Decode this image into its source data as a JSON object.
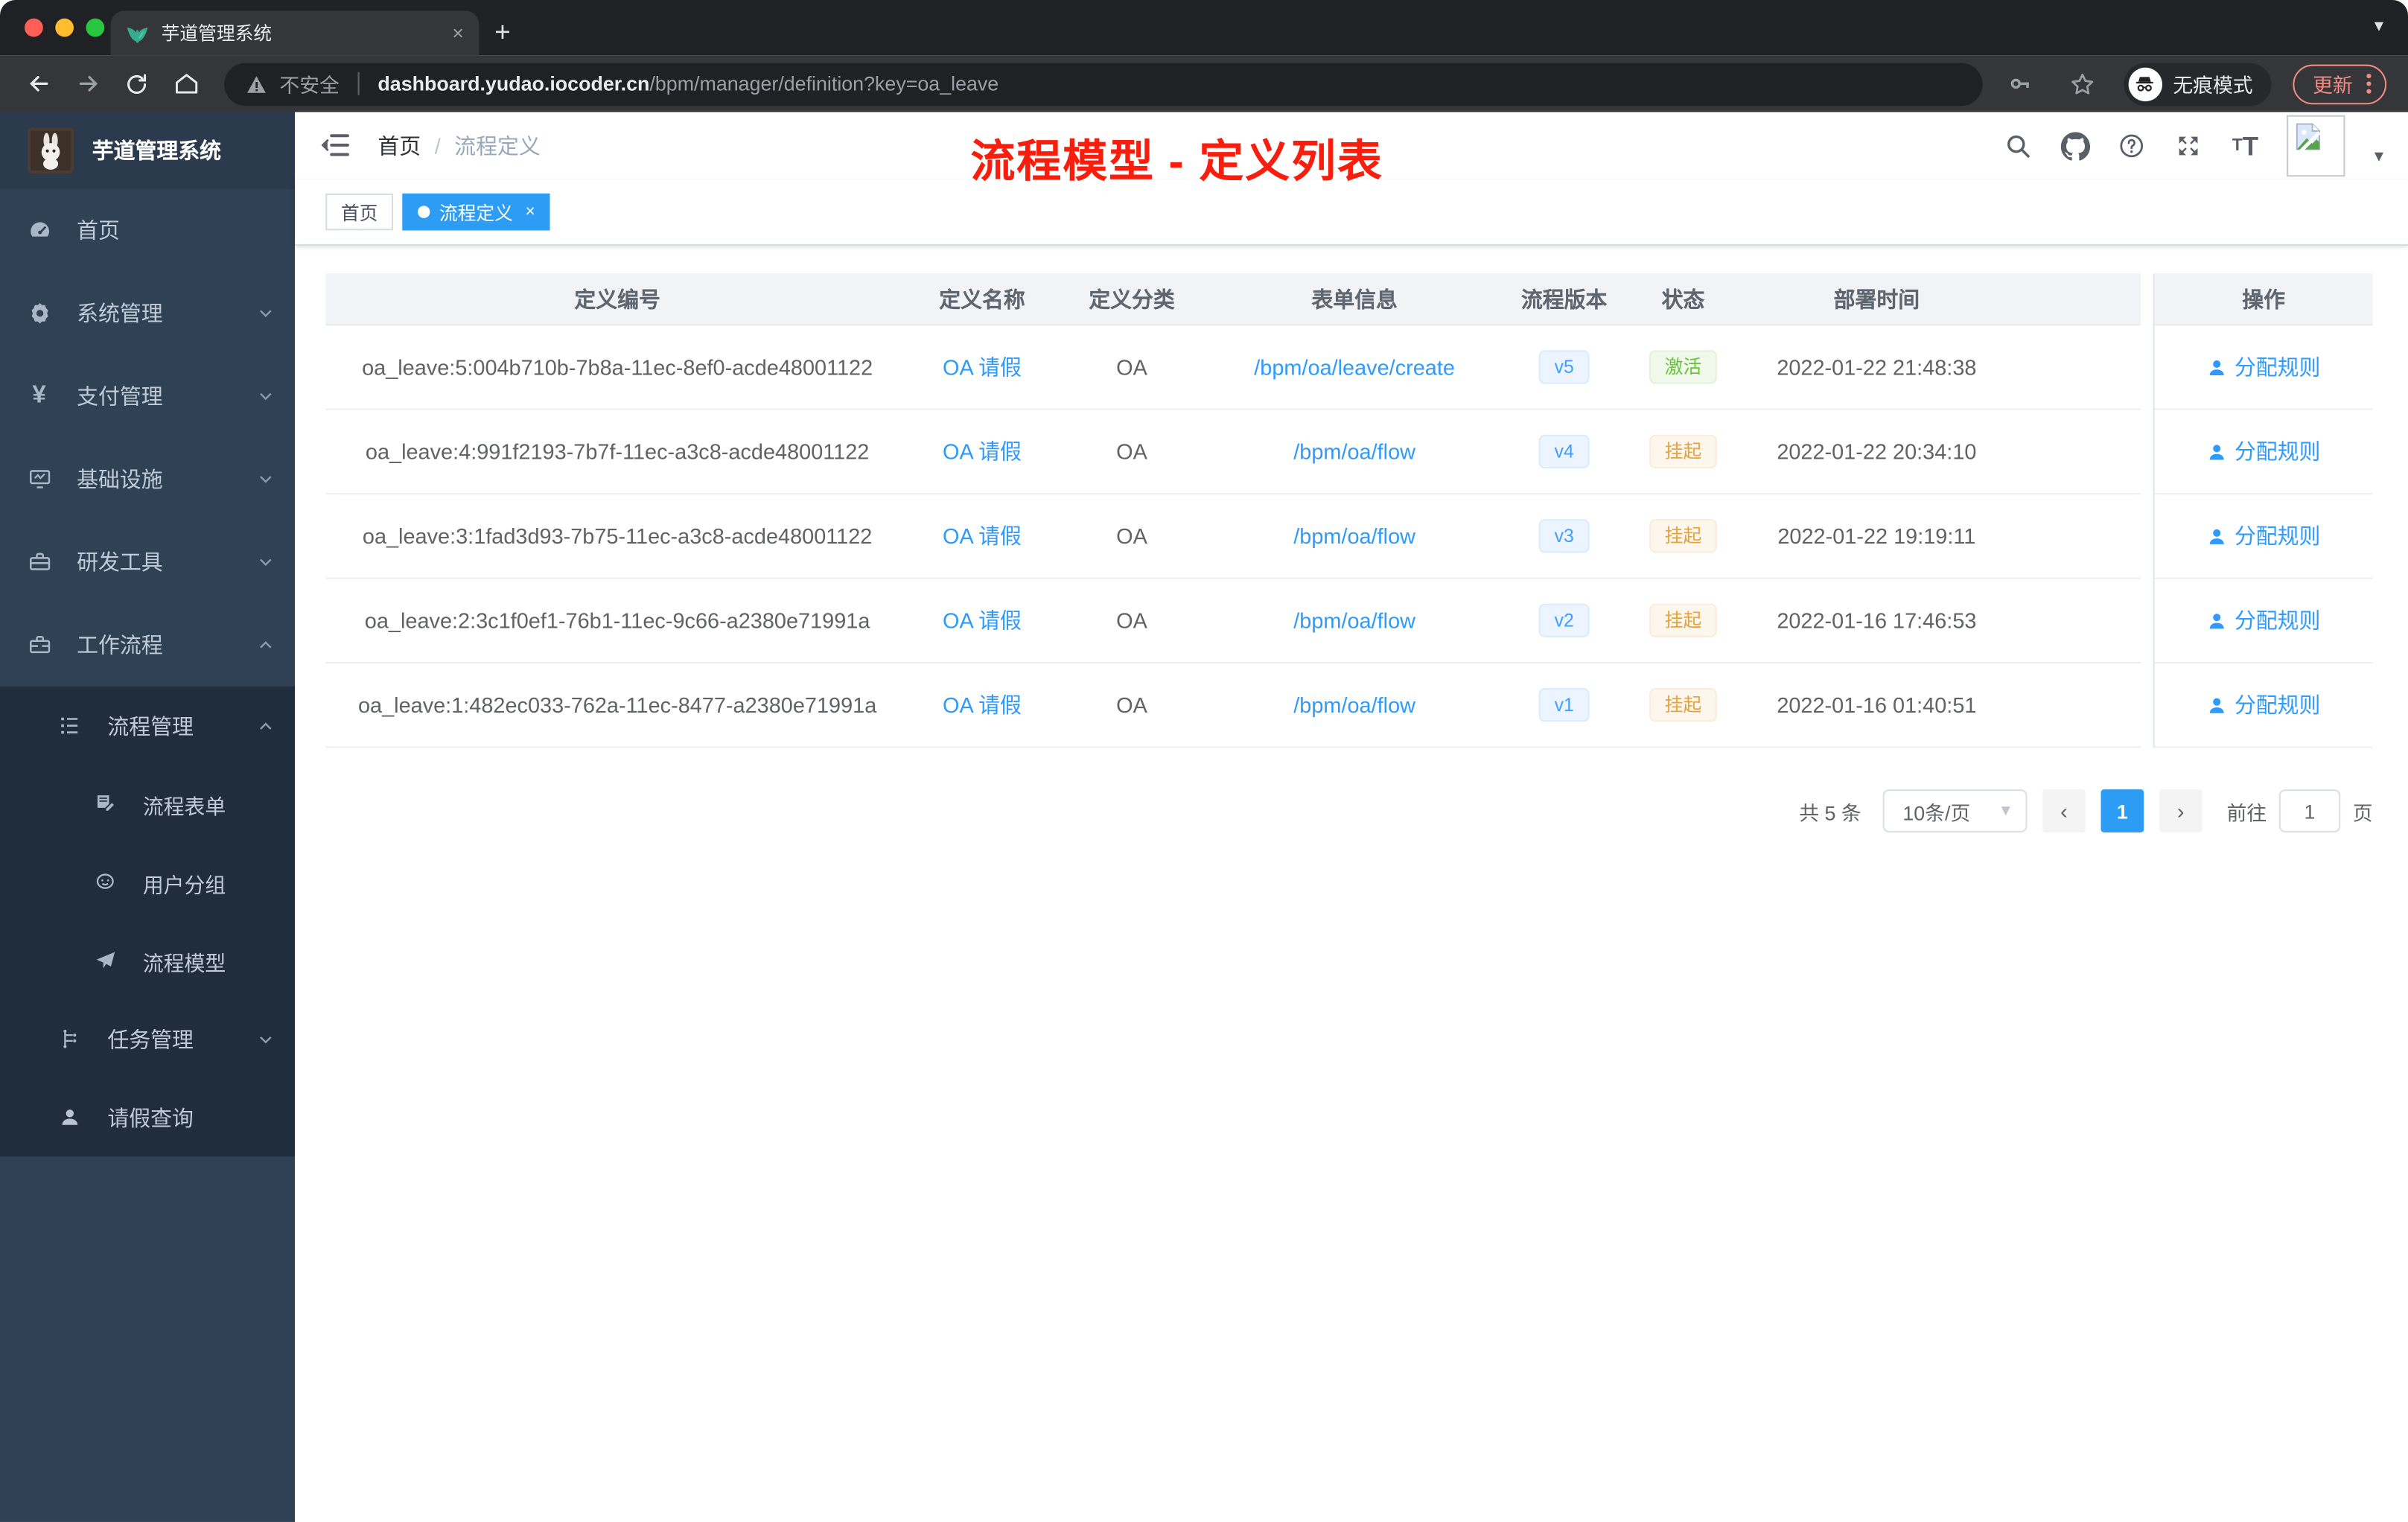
{
  "colors": {
    "accent": "#409eff",
    "tag_active": "#2d9cf4",
    "annotation_red": "#f81d0c",
    "status_success": "#67c23a",
    "status_warning": "#e6a23c",
    "sidebar_bg": "#304156",
    "submenu_bg": "#1f2d3d",
    "update_pill": "#f28b82"
  },
  "browser": {
    "tab_title": "芋道管理系统",
    "tab_close": "×",
    "new_tab": "+",
    "security_label": "不安全",
    "url_host": "dashboard.yudao.iocoder.cn",
    "url_path": "/bpm/manager/definition?key=oa_leave",
    "incognito_label": "无痕模式",
    "update_label": "更新"
  },
  "sidebar": {
    "logo_title": "芋道管理系统",
    "items": [
      {
        "label": "首页",
        "icon": "dashboard-icon",
        "arrow": ""
      },
      {
        "label": "系统管理",
        "icon": "gear-icon",
        "arrow": "down"
      },
      {
        "label": "支付管理",
        "icon": "yen-icon",
        "arrow": "down"
      },
      {
        "label": "基础设施",
        "icon": "monitor-icon",
        "arrow": "down"
      },
      {
        "label": "研发工具",
        "icon": "toolbox-icon",
        "arrow": "down"
      },
      {
        "label": "工作流程",
        "icon": "briefcase-icon",
        "arrow": "up"
      }
    ],
    "submenu": [
      {
        "label": "流程管理",
        "icon": "todo-list-icon",
        "arrow": "up",
        "level": 1
      },
      {
        "label": "流程表单",
        "icon": "form-edit-icon",
        "arrow": "",
        "level": 2
      },
      {
        "label": "用户分组",
        "icon": "people-icon",
        "arrow": "",
        "level": 2
      },
      {
        "label": "流程模型",
        "icon": "paper-plane-icon",
        "arrow": "",
        "level": 2
      },
      {
        "label": "任务管理",
        "icon": "tree-icon",
        "arrow": "down",
        "level": 1
      },
      {
        "label": "请假查询",
        "icon": "person-icon",
        "arrow": "",
        "level": 1
      }
    ]
  },
  "navbar": {
    "breadcrumb_home": "首页",
    "breadcrumb_separator": "/",
    "breadcrumb_current": "流程定义"
  },
  "annotation": {
    "text": "流程模型 - 定义列表"
  },
  "tags": {
    "first": "首页",
    "active": "流程定义",
    "active_close": "×"
  },
  "table": {
    "columns": [
      "定义编号",
      "定义名称",
      "定义分类",
      "表单信息",
      "流程版本",
      "状态",
      "部署时间",
      "操作"
    ],
    "rows": [
      {
        "id": "oa_leave:5:004b710b-7b8a-11ec-8ef0-acde48001122",
        "name": "OA 请假",
        "category": "OA",
        "form": "/bpm/oa/leave/create",
        "version": "v5",
        "status": "激活",
        "status_type": "success",
        "deployed_at": "2022-01-22 21:48:38",
        "action": "分配规则"
      },
      {
        "id": "oa_leave:4:991f2193-7b7f-11ec-a3c8-acde48001122",
        "name": "OA 请假",
        "category": "OA",
        "form": "/bpm/oa/flow",
        "version": "v4",
        "status": "挂起",
        "status_type": "warning",
        "deployed_at": "2022-01-22 20:34:10",
        "action": "分配规则"
      },
      {
        "id": "oa_leave:3:1fad3d93-7b75-11ec-a3c8-acde48001122",
        "name": "OA 请假",
        "category": "OA",
        "form": "/bpm/oa/flow",
        "version": "v3",
        "status": "挂起",
        "status_type": "warning",
        "deployed_at": "2022-01-22 19:19:11",
        "action": "分配规则"
      },
      {
        "id": "oa_leave:2:3c1f0ef1-76b1-11ec-9c66-a2380e71991a",
        "name": "OA 请假",
        "category": "OA",
        "form": "/bpm/oa/flow",
        "version": "v2",
        "status": "挂起",
        "status_type": "warning",
        "deployed_at": "2022-01-16 17:46:53",
        "action": "分配规则"
      },
      {
        "id": "oa_leave:1:482ec033-762a-11ec-8477-a2380e71991a",
        "name": "OA 请假",
        "category": "OA",
        "form": "/bpm/oa/flow",
        "version": "v1",
        "status": "挂起",
        "status_type": "warning",
        "deployed_at": "2022-01-16 01:40:51",
        "action": "分配规则"
      }
    ]
  },
  "pagination": {
    "total": "共 5 条",
    "page_size": "10条/页",
    "prev": "‹",
    "next": "›",
    "current_page": "1",
    "goto_label": "前往",
    "goto_value": "1",
    "page_unit": "页"
  }
}
